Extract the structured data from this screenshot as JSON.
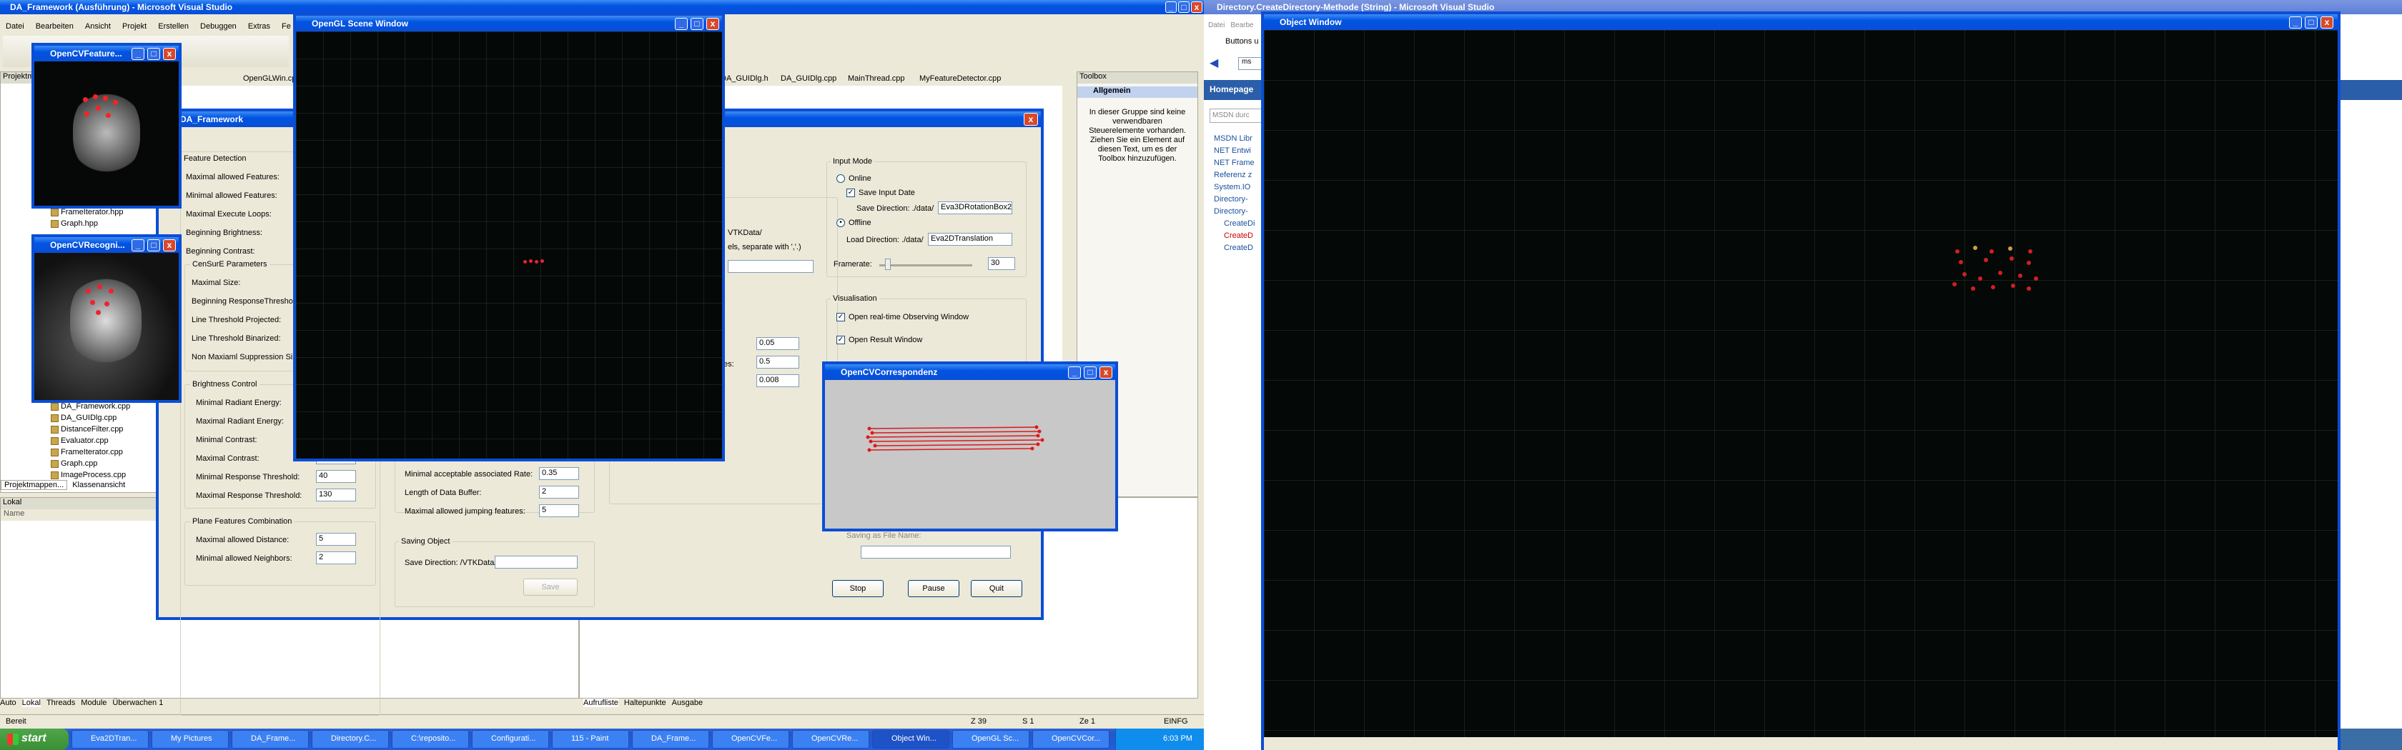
{
  "vs": {
    "title": "DA_Framework (Ausführung) - Microsoft Visual Studio",
    "menu": [
      "Datei",
      "Bearbeiten",
      "Ansicht",
      "Projekt",
      "Erstellen",
      "Debuggen",
      "Extras",
      "Fe"
    ],
    "tabs": [
      "OpenGLWin.cpp",
      "DA_GUIDlg.h",
      "DA_GUIDlg.cpp",
      "MainThread.cpp",
      "MyFeatureDetector.cpp"
    ],
    "solution_title": "Projektm",
    "tree_top": [
      "FrameIterator.hpp",
      "Graph.hpp"
    ],
    "tree_bottom": [
      "DA_Framework.cpp",
      "DA_GUIDlg.cpp",
      "DistanceFilter.cpp",
      "Evaluator.cpp",
      "FrameIterator.cpp",
      "Graph.cpp",
      "ImageProcess.cpp"
    ],
    "panel_tabs": [
      "Projektmappen...",
      "Klassenansicht"
    ],
    "locals_title": "Lokal",
    "locals_col_name": "Name",
    "bottom_tabs": [
      "Auto",
      "Lokal",
      "Threads",
      "Module",
      "Überwachen 1"
    ],
    "bottom_tabs_right": [
      "Aufrufliste",
      "Haltepunkte",
      "Ausgabe"
    ],
    "status_ready": "Bereit",
    "status_line": "Z 39",
    "status_col": "S 1",
    "status_char": "Ze 1",
    "status_mode": "EINFG",
    "toolbox_title": "Toolbox",
    "toolbox_group": "Allgemein",
    "toolbox_text": "In dieser Gruppe sind keine verwendbaren Steuerelemente vorhanden. Ziehen Sie ein Element auf diesen Text, um es der Toolbox hinzuzufügen.",
    "side_tab": "Lokal"
  },
  "feature_win": {
    "title": "OpenCVFeature..."
  },
  "recog_win": {
    "title": "OpenCVRecogni..."
  },
  "gl_win": {
    "title": "OpenGL Scene Window"
  },
  "corr_win": {
    "title": "OpenCVCorrespondenz"
  },
  "object_win": {
    "title": "Object Window"
  },
  "dlg": {
    "title": "DA_Framework",
    "feature_detection": "Feature Detection",
    "fd_labels": [
      "Maximal allowed Features:",
      "Minimal allowed Features:",
      "Maximal Execute Loops:",
      "Beginning Brightness:",
      "Beginning Contrast:"
    ],
    "censure": "CenSurE Parameters",
    "cs_labels": [
      "Maximal Size:",
      "Beginning ResponseThreshold:",
      "Line Threshold Projected:",
      "Line Threshold Binarized:",
      "Non Maxiaml Suppression Size:"
    ],
    "brightness": "Brightness Control",
    "bc_labels": [
      "Minimal Radiant Energy:",
      "Maximal Radiant Energy:",
      "Minimal Contrast:",
      "Maximal Contrast:",
      "Minimal Response Threshold:",
      "Maximal Response Threshold:"
    ],
    "bc_values": [
      "",
      "",
      "",
      "10",
      "40",
      "130"
    ],
    "plane": "Plane Features Combination",
    "pf_labels": [
      "Maximal allowed Distance:",
      "Minimal allowed Neighbors:"
    ],
    "pf_values": [
      "5",
      "2"
    ],
    "assoc_labels": [
      "Minimal acceptable associated Rate:",
      "Length of Data Buffer:",
      "Maximal allowed jumping features:"
    ],
    "assoc_values": [
      "0.35",
      "2",
      "5"
    ],
    "mid_values": [
      "0.05",
      "0.5",
      "0.008"
    ],
    "mid_label_es": "es:",
    "vtk_text": "VTKData/",
    "sep_text": "els, separate with ','.)",
    "saving": "Saving Object",
    "save_dir_label": "Save Direction: /VTKData/",
    "save_btn": "Save",
    "input_mode": "Input Mode",
    "online": "Online",
    "save_input": "Save Input Date",
    "save_dir2_label": "Save Direction: ./data/",
    "save_dir2_value": "Eva3DRotationBox2",
    "offline": "Offline",
    "load_dir_label": "Load Direction: ./data/",
    "load_dir_value": "Eva2DTranslation",
    "framerate_label": "Framerate:",
    "framerate_value": "30",
    "visualisation": "Visualisation",
    "vis1": "Open real-time Observing Window",
    "vis2": "Open Result Window",
    "stop": "Stop",
    "pause": "Pause",
    "quit": "Quit",
    "partial_label": "Saving as File Name:"
  },
  "ie": {
    "title": "Directory.CreateDirectory-Methode (String) - Microsoft Visual Studio",
    "menu": [
      "Datei",
      "Bearbe"
    ],
    "tab": "Buttons u",
    "addr": "ms",
    "homepage": "Homepage",
    "search": "MSDN durc",
    "nav": [
      "MSDN Libr",
      "NET Entwi",
      "NET Frame",
      "Referenz z",
      "System.IO",
      "Directory-",
      "Directory-"
    ],
    "nav_sub": [
      "CreateDi",
      "CreateD",
      "CreateD"
    ],
    "logo": "msdn"
  },
  "taskbar": {
    "start": "start",
    "items": [
      "Eva2DTran...",
      "My Pictures",
      "DA_Frame...",
      "Directory.C...",
      "C:\\reposito...",
      "Configurati...",
      "115 - Paint",
      "DA_Frame...",
      "OpenCVFe...",
      "OpenCVRe...",
      "Object Win...",
      "OpenGL Sc...",
      "OpenCVCor..."
    ],
    "clock": "6:03 PM"
  }
}
